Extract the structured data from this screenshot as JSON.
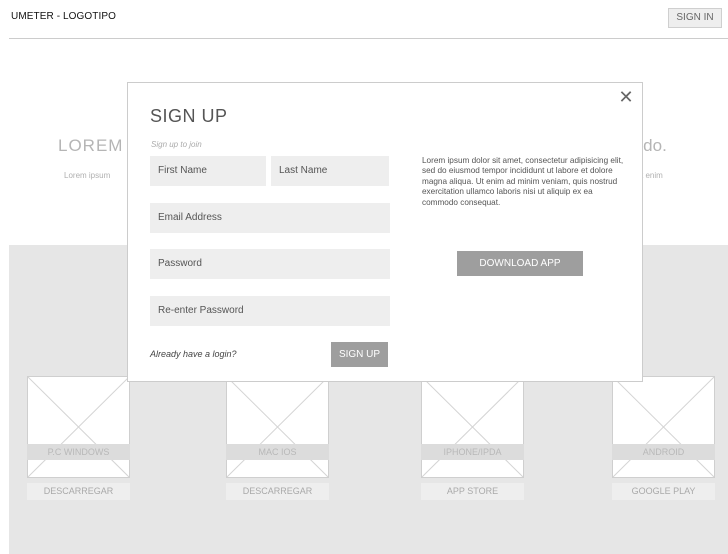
{
  "header": {
    "logo": "UMETER - LOGOTIPO",
    "signin_label": "SIGN IN"
  },
  "hero": {
    "title_left": "LOREM",
    "sub_left": "Lorem ipsum",
    "title_right": "d do.",
    "sub_right": "t enim"
  },
  "platforms": [
    {
      "label": "P.C WINDOWS",
      "button": "DESCARREGAR"
    },
    {
      "label": "MAC IOS",
      "button": "DESCARREGAR"
    },
    {
      "label": "IPHONE/IPDA",
      "button": "APP STORE"
    },
    {
      "label": "ANDROID",
      "button": "GOOGLE PLAY"
    }
  ],
  "modal": {
    "close_symbol": "✕",
    "title": "SIGN UP",
    "subtitle": "Sign up to join",
    "first_name": "First Name",
    "last_name": "Last Name",
    "email": "Email Address",
    "password": "Password",
    "reenter_password": "Re-enter Password",
    "login_prompt": "Already have a login?",
    "signup_label": "SIGN UP",
    "description": "Lorem ipsum dolor sit amet, consectetur adipisicing elit, sed do eiusmod tempor incididunt ut labore et dolore magna aliqua. Ut enim ad minim veniam, quis nostrud exercitation ullamco laboris nisi ut aliquip ex ea commodo consequat.",
    "download_label": "DOWNLOAD APP"
  }
}
